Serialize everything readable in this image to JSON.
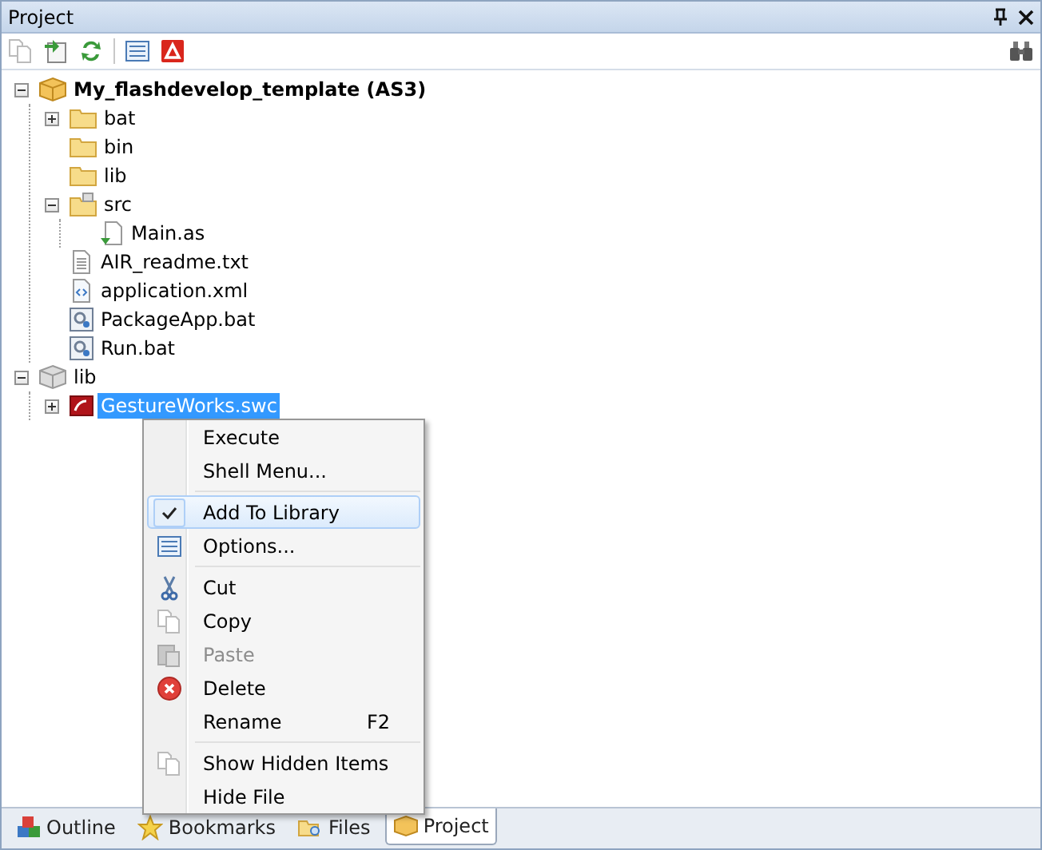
{
  "panel": {
    "title": "Project"
  },
  "tree": [
    {
      "label": "My_flashdevelop_template (AS3)",
      "kind": "project",
      "expanded": true,
      "selected": false,
      "children": [
        {
          "label": "bat",
          "kind": "folder",
          "expanded": false,
          "selected": false
        },
        {
          "label": "bin",
          "kind": "folder",
          "selected": false
        },
        {
          "label": "lib",
          "kind": "folder",
          "selected": false
        },
        {
          "label": "src",
          "kind": "source-folder",
          "expanded": true,
          "selected": false,
          "children": [
            {
              "label": "Main.as",
              "kind": "source-file",
              "selected": false
            }
          ]
        },
        {
          "label": "AIR_readme.txt",
          "kind": "text-file",
          "selected": false
        },
        {
          "label": "application.xml",
          "kind": "xml-file",
          "selected": false
        },
        {
          "label": "PackageApp.bat",
          "kind": "batch-file",
          "selected": false
        },
        {
          "label": "Run.bat",
          "kind": "batch-file",
          "selected": false
        }
      ]
    },
    {
      "label": "lib",
      "kind": "library",
      "expanded": true,
      "selected": false,
      "children": [
        {
          "label": "GestureWorks.swc",
          "kind": "swc",
          "expanded": false,
          "selected": true
        }
      ]
    }
  ],
  "context_menu": [
    [
      {
        "label": "Execute",
        "kind": "plain",
        "checked": false,
        "disabled": false,
        "selected": false
      },
      {
        "label": "Shell Menu...",
        "kind": "plain",
        "checked": false,
        "disabled": false,
        "selected": false
      }
    ],
    [
      {
        "label": "Add To Library",
        "checked": true,
        "disabled": false,
        "selected": true
      },
      {
        "label": "Options...",
        "kind": "options",
        "checked": false,
        "disabled": false,
        "selected": false
      }
    ],
    [
      {
        "label": "Cut",
        "kind": "cut",
        "checked": false,
        "disabled": false,
        "selected": false
      },
      {
        "label": "Copy",
        "kind": "copy",
        "checked": false,
        "disabled": false,
        "selected": false
      },
      {
        "label": "Paste",
        "kind": "paste",
        "checked": false,
        "disabled": true,
        "selected": false
      },
      {
        "label": "Delete",
        "kind": "delete",
        "checked": false,
        "disabled": false,
        "selected": false
      },
      {
        "label": "Rename",
        "kind": "plain",
        "checked": false,
        "disabled": false,
        "selected": false,
        "shortcut": "F2"
      }
    ],
    [
      {
        "label": "Show Hidden Items",
        "kind": "copy",
        "checked": false,
        "disabled": false,
        "selected": false
      },
      {
        "label": "Hide File",
        "kind": "plain",
        "checked": false,
        "disabled": false,
        "selected": false
      }
    ]
  ],
  "bottom_tabs": [
    {
      "label": "Outline",
      "kind": "outline",
      "selected": false
    },
    {
      "label": "Bookmarks",
      "kind": "bookmarks",
      "selected": false
    },
    {
      "label": "Files",
      "kind": "files",
      "selected": false
    },
    {
      "label": "Project",
      "kind": "project",
      "selected": true
    }
  ]
}
